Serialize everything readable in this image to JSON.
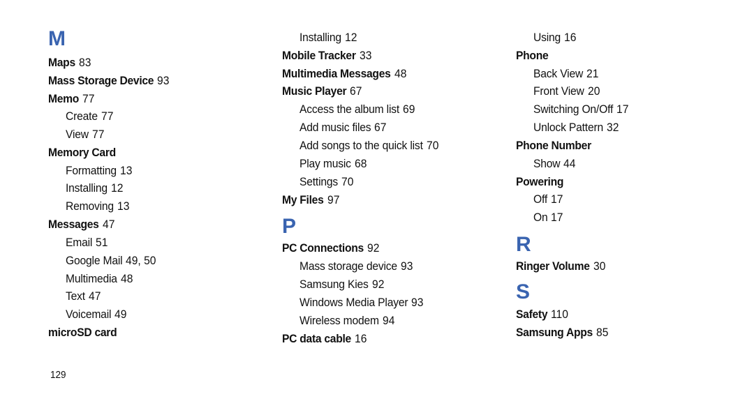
{
  "index_page": {
    "page_number": "129",
    "accent_color": "#3a64b0",
    "columns": [
      {
        "entries": [
          {
            "type": "letter",
            "text": "M"
          },
          {
            "type": "term",
            "term": "Maps",
            "pages": "83"
          },
          {
            "type": "term",
            "term": "Mass Storage Device",
            "pages": "93"
          },
          {
            "type": "term",
            "term": "Memo",
            "pages": "77"
          },
          {
            "type": "sub",
            "term": "Create",
            "pages": "77"
          },
          {
            "type": "sub",
            "term": "View",
            "pages": "77"
          },
          {
            "type": "term",
            "term": "Memory Card",
            "pages": ""
          },
          {
            "type": "sub",
            "term": "Formatting",
            "pages": "13"
          },
          {
            "type": "sub",
            "term": "Installing",
            "pages": "12"
          },
          {
            "type": "sub",
            "term": "Removing",
            "pages": "13"
          },
          {
            "type": "term",
            "term": "Messages",
            "pages": "47"
          },
          {
            "type": "sub",
            "term": "Email",
            "pages": "51"
          },
          {
            "type": "sub",
            "term": "Google Mail",
            "pages": "49, 50"
          },
          {
            "type": "sub",
            "term": "Multimedia",
            "pages": "48"
          },
          {
            "type": "sub",
            "term": "Text",
            "pages": "47"
          },
          {
            "type": "sub",
            "term": "Voicemail",
            "pages": "49"
          },
          {
            "type": "term",
            "term": "microSD card",
            "pages": ""
          }
        ]
      },
      {
        "entries": [
          {
            "type": "sub",
            "term": "Installing",
            "pages": "12"
          },
          {
            "type": "term",
            "term": "Mobile Tracker",
            "pages": "33"
          },
          {
            "type": "term",
            "term": "Multimedia Messages",
            "pages": "48"
          },
          {
            "type": "term",
            "term": "Music Player",
            "pages": "67"
          },
          {
            "type": "sub",
            "term": "Access the album list",
            "pages": "69"
          },
          {
            "type": "sub",
            "term": "Add music files",
            "pages": "67"
          },
          {
            "type": "sub",
            "term": "Add songs to the quick list",
            "pages": "70"
          },
          {
            "type": "sub",
            "term": "Play music",
            "pages": "68"
          },
          {
            "type": "sub",
            "term": "Settings",
            "pages": "70"
          },
          {
            "type": "term",
            "term": "My Files",
            "pages": "97"
          },
          {
            "type": "letter",
            "text": "P"
          },
          {
            "type": "term",
            "term": "PC Connections",
            "pages": "92"
          },
          {
            "type": "sub",
            "term": "Mass storage device",
            "pages": "93"
          },
          {
            "type": "sub",
            "term": "Samsung Kies",
            "pages": "92"
          },
          {
            "type": "sub",
            "term": "Windows Media Player",
            "pages": "93"
          },
          {
            "type": "sub",
            "term": "Wireless modem",
            "pages": "94"
          },
          {
            "type": "term",
            "term": "PC data cable",
            "pages": "16"
          }
        ]
      },
      {
        "entries": [
          {
            "type": "sub",
            "term": "Using",
            "pages": "16"
          },
          {
            "type": "term",
            "term": "Phone",
            "pages": ""
          },
          {
            "type": "sub",
            "term": "Back View",
            "pages": "21"
          },
          {
            "type": "sub",
            "term": "Front View",
            "pages": "20"
          },
          {
            "type": "sub",
            "term": "Switching On/Off",
            "pages": "17"
          },
          {
            "type": "sub",
            "term": "Unlock Pattern",
            "pages": "32"
          },
          {
            "type": "term",
            "term": "Phone Number",
            "pages": ""
          },
          {
            "type": "sub",
            "term": "Show",
            "pages": "44"
          },
          {
            "type": "term",
            "term": "Powering",
            "pages": ""
          },
          {
            "type": "sub",
            "term": "Off",
            "pages": "17"
          },
          {
            "type": "sub",
            "term": "On",
            "pages": "17"
          },
          {
            "type": "letter",
            "text": "R"
          },
          {
            "type": "term",
            "term": "Ringer Volume",
            "pages": "30"
          },
          {
            "type": "letter",
            "text": "S"
          },
          {
            "type": "term",
            "term": "Safety",
            "pages": "110"
          },
          {
            "type": "term",
            "term": "Samsung Apps",
            "pages": "85"
          }
        ]
      }
    ]
  }
}
